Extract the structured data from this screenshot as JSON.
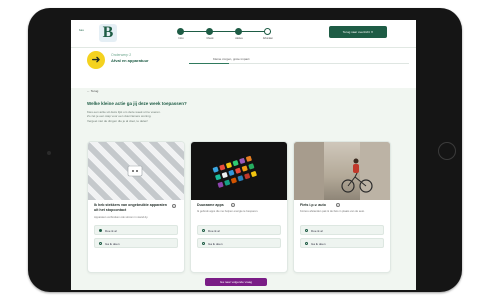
{
  "topbar": {
    "logo_small": "bas",
    "logo_letter": "B",
    "steps": [
      {
        "label": "Intro"
      },
      {
        "label": "Check"
      },
      {
        "label": "Advies"
      },
      {
        "label": "Afronden"
      }
    ],
    "save_button": "Terug naar overzicht ✕"
  },
  "progress": {
    "category": "Onderwerp 2",
    "title": "Afval en apparatuur",
    "step_text": "Kleine zorgen, grote impact",
    "fill_percent": 18,
    "icon": "arrow-right-icon"
  },
  "back": "← Terug",
  "question": "Welke kleine actie ga jij deze week toepassen?",
  "description": [
    "Kies een actie uit deze lijst om deze week uit te voeren.",
    "Zo zet je een stap voor een duurzamere woning.",
    "Vergeet niet de dingen die je al doet, te delen!"
  ],
  "cards": [
    {
      "title": "Ik heb stekkers van ongebruikte apparaten uit het stopcontact",
      "desc": "Apparaten verbruiken ook stroom in stand-by.",
      "opt1": "Doe ik al",
      "opt2": "Ga ik doen"
    },
    {
      "title": "Duurzame apps",
      "desc": "Ik gebruik apps die me helpen energie te besparen.",
      "opt1": "Doe ik al",
      "opt2": "Ga ik doen"
    },
    {
      "title": "Fiets i.p.v. auto",
      "desc": "Kortere afstanden pak ik de fiets in plaats van de auto.",
      "opt1": "Doe ik al",
      "opt2": "Ga ik doen"
    }
  ],
  "next_button": "Ga naar volgende vraag",
  "colors": {
    "accent": "#1e5c45",
    "yellow": "#f4d21f",
    "purple": "#7a1d86"
  }
}
